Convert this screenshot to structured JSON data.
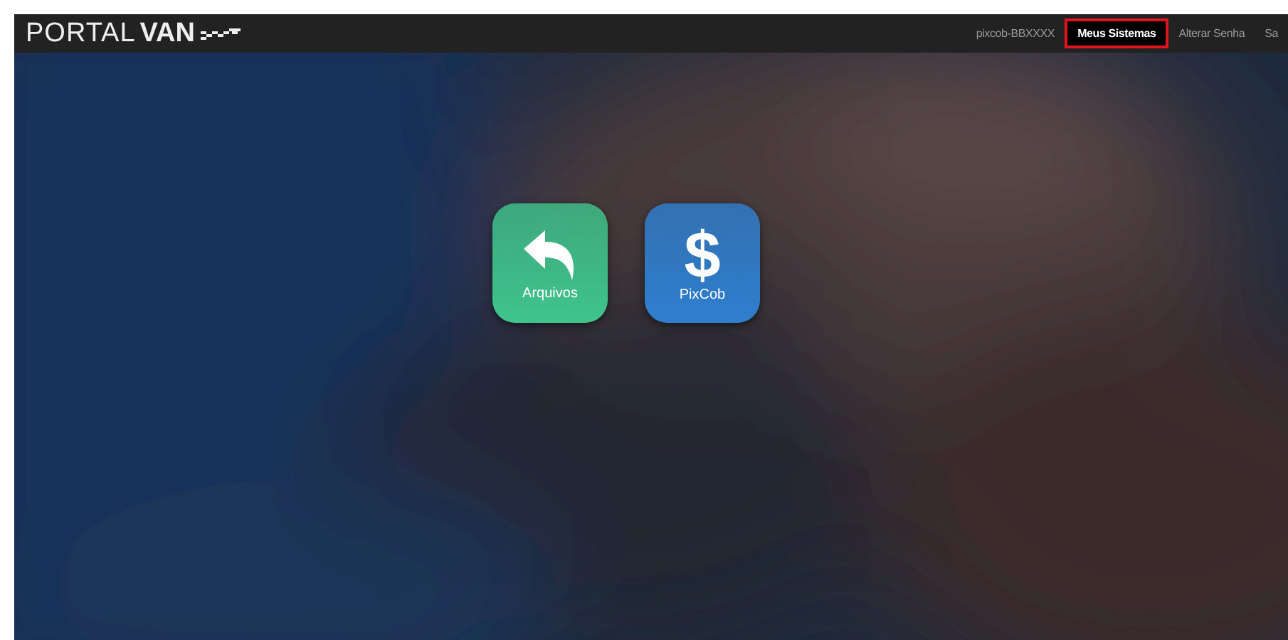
{
  "logo": {
    "light": "PORTAL",
    "bold": "VAN"
  },
  "nav": [
    {
      "label": "pixcob-BBXXXX",
      "selected": false
    },
    {
      "label": "Meus Sistemas",
      "selected": true
    },
    {
      "label": "Alterar Senha",
      "selected": false
    },
    {
      "label": "Sa",
      "selected": false
    }
  ],
  "apps": [
    {
      "kind": "arrow",
      "label": "Arquivos",
      "color": "#3fc48c"
    },
    {
      "kind": "dollar",
      "label": "PixCob",
      "glyph": "$",
      "color": "#2f7fcf"
    }
  ]
}
